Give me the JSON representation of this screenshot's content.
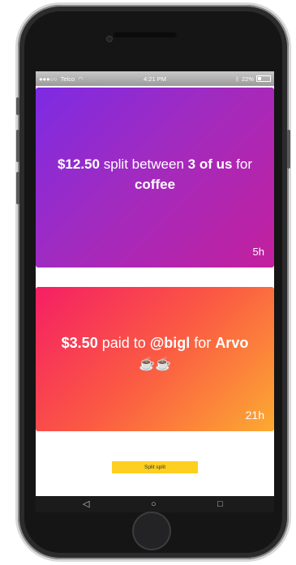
{
  "status_bar": {
    "carrier": "Telco",
    "time": "4:21 PM",
    "battery": "22%",
    "battery_level": 0.22
  },
  "cards": [
    {
      "amount": "$12.50",
      "text_1": " split between ",
      "who": "3 of us",
      "text_2": " for ",
      "item": "coffee",
      "age": "5h"
    },
    {
      "amount": "$3.50",
      "text_1": " paid to ",
      "who": "@bigl",
      "text_2": " for ",
      "item": "Arvo",
      "emoji": "☕☕",
      "age": "21h"
    }
  ],
  "split_button_label": "Split split",
  "navbar": {
    "back_icon": "back-triangle-icon",
    "home_icon": "home-circle-icon",
    "recents_icon": "recents-square-icon"
  },
  "colors": {
    "card1_start": "#7d2be3",
    "card1_end": "#c3209d",
    "card2_start": "#f51f64",
    "card2_end": "#fcaa32",
    "button": "#fccf20"
  }
}
